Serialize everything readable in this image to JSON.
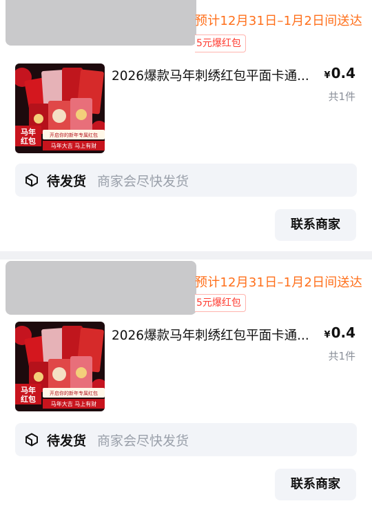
{
  "orders": [
    {
      "eta": "预计12月31日–1月2日间送达",
      "coupon": "5元爆红包",
      "product_title": "2026爆款马年刺绣红包平面卡通...",
      "currency": "¥",
      "price": "0.4",
      "qty": "共1件",
      "status": "待发货",
      "status_sub": "商家会尽快发货",
      "contact": "联系商家",
      "thumb": {
        "badge_line1": "马年",
        "badge_line2": "红包",
        "banner_top": "开启你的新年专属红包",
        "banner_bottom": "马年大吉 马上有财"
      }
    },
    {
      "eta": "预计12月31日–1月2日间送达",
      "coupon": "5元爆红包",
      "product_title": "2026爆款马年刺绣红包平面卡通...",
      "currency": "¥",
      "price": "0.4",
      "qty": "共1件",
      "status": "待发货",
      "status_sub": "商家会尽快发货",
      "contact": "联系商家",
      "thumb": {
        "badge_line1": "马年",
        "badge_line2": "红包",
        "banner_top": "开启你的新年专属红包",
        "banner_bottom": "马年大吉 马上有财"
      }
    }
  ]
}
